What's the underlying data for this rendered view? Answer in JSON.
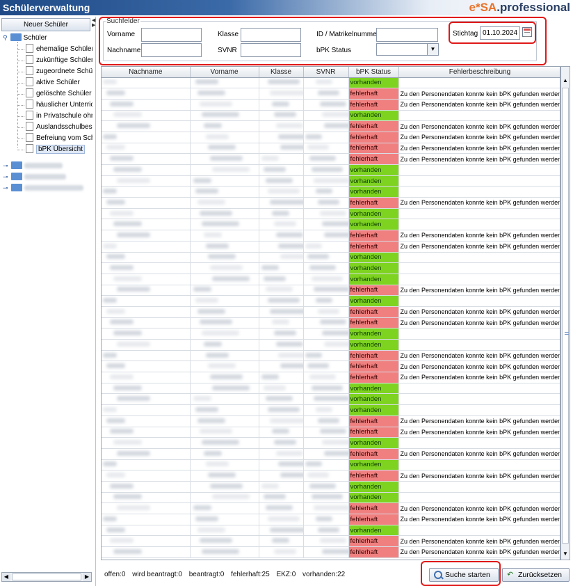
{
  "header": {
    "title": "Schülerverwaltung",
    "brand_prefix": "e*SA",
    "brand_suffix": ".professional"
  },
  "left_panel": {
    "new_button": "Neuer Schüler",
    "tree_root": "Schüler",
    "tree_items": [
      "ehemalige Schüler",
      "zukünftige Schüler",
      "zugeordnete Schüler",
      "aktive Schüler",
      "gelöschte Schüler",
      "häuslicher Unterricht",
      "in Privatschule ohne",
      "Auslandsschulbesuch",
      "Befreiung vom Schulbesuch",
      "bPK Übersicht"
    ]
  },
  "search": {
    "legend": "Suchfelder",
    "vorname_label": "Vorname",
    "nachname_label": "Nachname",
    "klasse_label": "Klasse",
    "svnr_label": "SVNR",
    "id_label": "ID / Matrikelnummer",
    "bpk_status_label": "bPK Status",
    "stichtag_label": "Stichtag",
    "stichtag_value": "01.10.2024"
  },
  "table": {
    "columns": [
      "Nachname",
      "Vorname",
      "Klasse",
      "SVNR",
      "bPK Status",
      "Fehlerbeschreibung"
    ],
    "ok_label": "vorhanden",
    "bad_label": "fehlerhaft",
    "error_text": "Zu den Personendaten konnte kein bPK gefunden werden!",
    "rows": [
      "vorhanden",
      "fehlerhaft",
      "fehlerhaft",
      "vorhanden",
      "fehlerhaft",
      "fehlerhaft",
      "fehlerhaft",
      "fehlerhaft",
      "vorhanden",
      "vorhanden",
      "vorhanden",
      "fehlerhaft",
      "vorhanden",
      "vorhanden",
      "fehlerhaft",
      "fehlerhaft",
      "vorhanden",
      "vorhanden",
      "vorhanden",
      "fehlerhaft",
      "vorhanden",
      "fehlerhaft",
      "fehlerhaft",
      "vorhanden",
      "vorhanden",
      "fehlerhaft",
      "fehlerhaft",
      "fehlerhaft",
      "vorhanden",
      "vorhanden",
      "vorhanden",
      "fehlerhaft",
      "fehlerhaft",
      "vorhanden",
      "fehlerhaft",
      "vorhanden",
      "fehlerhaft",
      "vorhanden",
      "vorhanden",
      "fehlerhaft",
      "fehlerhaft",
      "vorhanden",
      "fehlerhaft",
      "fehlerhaft"
    ]
  },
  "footer": {
    "offen": "offen:0",
    "wird_beantragt": "wird beantragt:0",
    "beantragt": "beantragt:0",
    "fehlerhaft": "fehlerhaft:25",
    "ekz": "EKZ:0",
    "vorhanden": "vorhanden:22",
    "search_button": "Suche starten",
    "reset_button": "Zurücksetzen"
  },
  "colors": {
    "ok": "#7ed321",
    "bad": "#f08080",
    "highlight": "#e01818"
  },
  "icons": [
    "folder-icon",
    "document-icon",
    "calendar-icon",
    "search-icon",
    "undo-icon",
    "dropdown-arrow-icon"
  ]
}
